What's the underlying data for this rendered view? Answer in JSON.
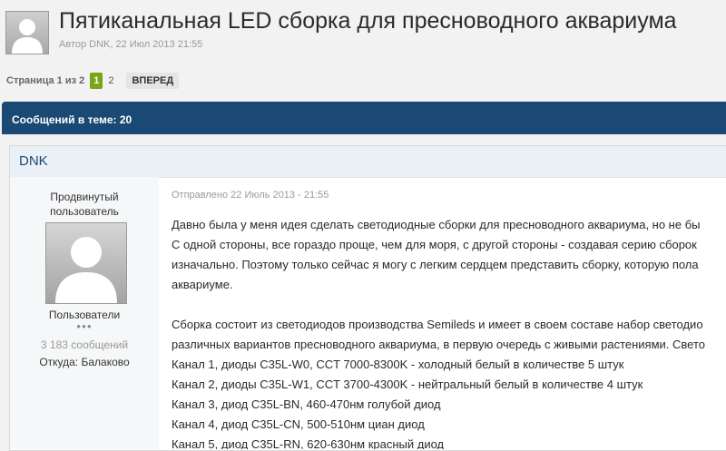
{
  "topic": {
    "title": "Пятиканальная LED сборка для пресноводного аквариума",
    "meta_prefix": "Автор",
    "author": "DNK",
    "date": ", 22 Июл 2013 21:55"
  },
  "pagination": {
    "label": "Страница 1 из 2",
    "current": "1",
    "page2": "2",
    "next": "ВПЕРЕД"
  },
  "thread": {
    "count_text": "Сообщений в теме: 20"
  },
  "post": {
    "author_name": "DNK",
    "author_rank_line1": "Продвинутый",
    "author_rank_line2": "пользователь",
    "author_group": "Пользователи",
    "reputation_dots": "●●●",
    "author_posts": "3 183 сообщений",
    "author_location": "Откуда: Балаково",
    "posted": "Отправлено 22 Июль 2013 - 21:55",
    "paragraph1": [
      "Давно была у меня идея сделать светодиодные сборки для пресноводного аквариума, но не бы",
      "С одной стороны, все гораздо проще, чем для моря, с другой стороны - создавая серию сборок",
      "изначально. Поэтому только сейчас я могу с легким сердцем представить сборку, которую пола",
      "аквариуме."
    ],
    "paragraph2": [
      "Сборка состоит из светодиодов производства Semileds и имеет в своем составе набор светодио",
      "различных вариантов пресноводного аквариума, в первую очередь с живыми растениями. Свето",
      "Канал 1, диоды C35L-W0, CCT 7000-8300K - холодный белый в количестве 5 штук",
      "Канал 2, диоды C35L-W1, CCT 3700-4300K - нейтральный белый в количестве 4 штук",
      "Канал 3, диод C35L-BN, 460-470нм голубой диод",
      "Канал 4, диод C35L-CN, 500-510нм циан диод",
      "Канал 5, диод C35L-RN, 620-630нм красный диод"
    ]
  },
  "colors": {
    "thread_bar": "#1a4a73",
    "current_page": "#7ba416",
    "link": "#1a4a73"
  }
}
